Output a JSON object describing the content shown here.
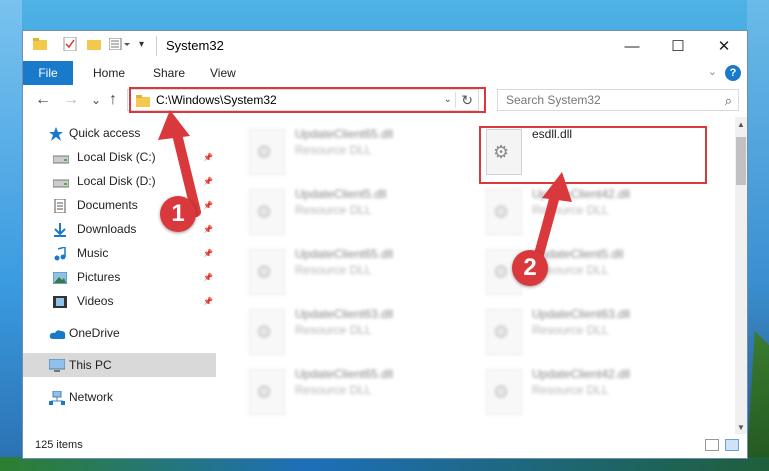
{
  "window": {
    "title": "System32",
    "buttons": {
      "minimize": "—",
      "maximize": "☐",
      "close": "✕"
    }
  },
  "ribbon": {
    "file": "File",
    "tabs": [
      "Home",
      "Share",
      "View"
    ],
    "help": "?"
  },
  "nav": {
    "back": "←",
    "forward": "→",
    "recent": "⌄",
    "up": "↑"
  },
  "address": {
    "path": "C:\\Windows\\System32",
    "refresh": "↻"
  },
  "search": {
    "placeholder": "Search System32"
  },
  "sidebar": {
    "items": [
      {
        "label": "Quick access",
        "icon": "star-icon",
        "pinned": false
      },
      {
        "label": "Local Disk (C:)",
        "icon": "drive-icon",
        "pinned": true
      },
      {
        "label": "Local Disk (D:)",
        "icon": "drive-icon",
        "pinned": true
      },
      {
        "label": "Documents",
        "icon": "documents-icon",
        "pinned": true
      },
      {
        "label": "Downloads",
        "icon": "download-icon",
        "pinned": true
      },
      {
        "label": "Music",
        "icon": "music-icon",
        "pinned": true
      },
      {
        "label": "Pictures",
        "icon": "pictures-icon",
        "pinned": true
      },
      {
        "label": "Videos",
        "icon": "videos-icon",
        "pinned": true
      },
      {
        "label": "OneDrive",
        "icon": "cloud-icon",
        "pinned": false
      },
      {
        "label": "This PC",
        "icon": "computer-icon",
        "pinned": false,
        "selected": true
      },
      {
        "label": "Network",
        "icon": "network-icon",
        "pinned": false
      }
    ]
  },
  "files": [
    {
      "name": "UpdateClient65.dll",
      "type": "Resource DLL",
      "blurred": true
    },
    {
      "name": "esdll.dll",
      "type": "",
      "blurred": false
    },
    {
      "name": "UpdateClient5.dll",
      "type": "Resource DLL",
      "blurred": true
    },
    {
      "name": "UpdateClient42.dll",
      "type": "Resource DLL",
      "blurred": true
    },
    {
      "name": "UpdateClient65.dll",
      "type": "Resource DLL",
      "blurred": true
    },
    {
      "name": "UpdateClient5.dll",
      "type": "Resource DLL",
      "blurred": true
    },
    {
      "name": "UpdateClient63.dll",
      "type": "Resource DLL",
      "blurred": true
    },
    {
      "name": "UpdateClient63.dll",
      "type": "Resource DLL",
      "blurred": true
    },
    {
      "name": "UpdateClient65.dll",
      "type": "Resource DLL",
      "blurred": true
    },
    {
      "name": "UpdateClient42.dll",
      "type": "Resource DLL",
      "blurred": true
    }
  ],
  "status": {
    "count": "125 items"
  },
  "annotations": {
    "step1": "1",
    "step2": "2"
  },
  "colors": {
    "accent": "#1979ca",
    "highlight": "#d9393c",
    "selected": "#d9d9d9"
  }
}
